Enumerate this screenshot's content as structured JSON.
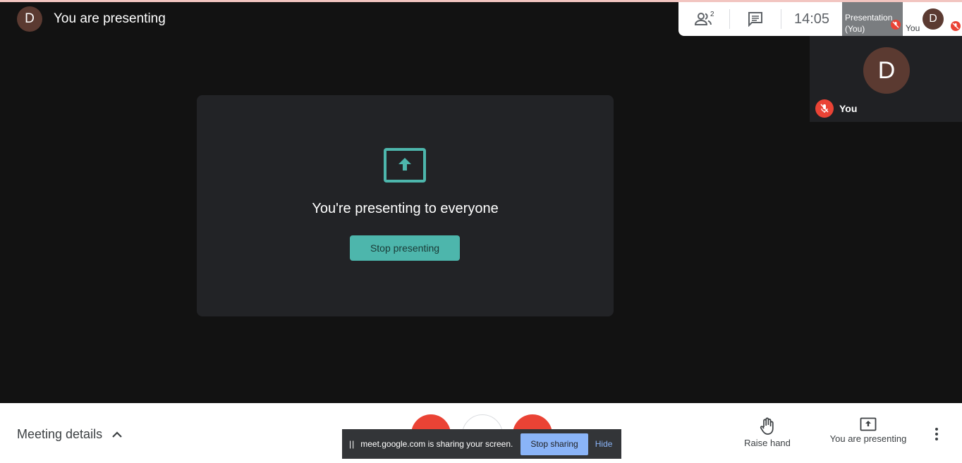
{
  "header": {
    "avatar_initial": "D",
    "title": "You are presenting"
  },
  "top_bar": {
    "people_count": "2",
    "clock": "14:05",
    "presentation_thumb_label": "Presentation (You)",
    "self_thumb_initial": "D",
    "self_thumb_label": "You"
  },
  "self_tile": {
    "initial": "D",
    "name": "You"
  },
  "present_card": {
    "message": "You're presenting to everyone",
    "stop_button": "Stop presenting"
  },
  "bottom_bar": {
    "meeting_details": "Meeting details",
    "raise_hand": "Raise hand",
    "you_are_presenting": "You are presenting"
  },
  "share_notice": {
    "pause_icon": "||",
    "message": "meet.google.com is sharing your screen.",
    "stop_sharing": "Stop sharing",
    "hide": "Hide"
  },
  "colors": {
    "accent_teal": "#4db6ac",
    "mic_off_red": "#ea4335",
    "avatar": "#5b3a31",
    "share_button_blue": "#8ab4f8"
  }
}
